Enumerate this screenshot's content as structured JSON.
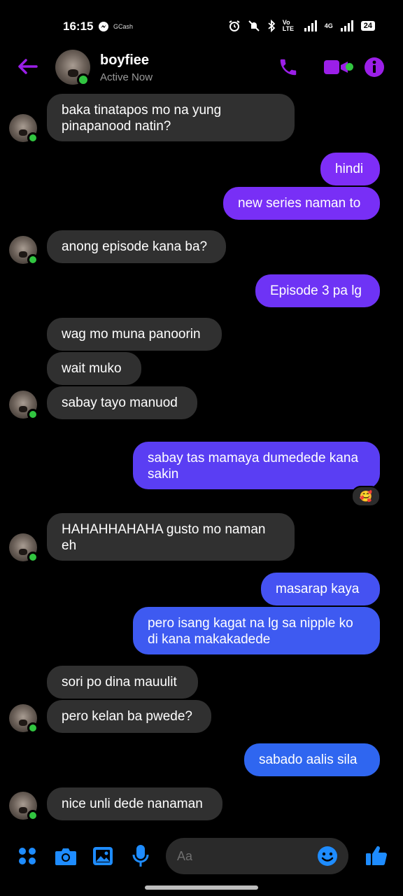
{
  "status_bar": {
    "time": "16:15",
    "left_app_label": "GCash",
    "network_label": "Vo LTE",
    "network_type": "4G",
    "battery": "24"
  },
  "header": {
    "contact_name": "boyfiee",
    "active_status": "Active Now"
  },
  "messages": [
    {
      "side": "in",
      "lines": [
        "baka tinatapos mo na yung",
        "pinapanood natin?"
      ]
    },
    {
      "side": "out",
      "text": "hindi"
    },
    {
      "side": "out",
      "text": "new series naman to"
    },
    {
      "side": "in",
      "text": "anong episode kana ba?"
    },
    {
      "side": "out",
      "text": "Episode 3 pa lg"
    },
    {
      "side": "in",
      "text": "wag mo muna panoorin"
    },
    {
      "side": "in",
      "text": "wait muko"
    },
    {
      "side": "in",
      "text": "sabay tayo manuod"
    },
    {
      "side": "out",
      "lines": [
        "sabay tas mamaya dumedede kana",
        "sakin"
      ],
      "reaction": "🥰"
    },
    {
      "side": "in",
      "lines": [
        "HAHAHHAHAHA gusto mo naman",
        "eh"
      ]
    },
    {
      "side": "out",
      "text": "masarap kaya"
    },
    {
      "side": "out",
      "lines": [
        "pero isang kagat na lg sa nipple ko",
        "di kana makakadede"
      ]
    },
    {
      "side": "in",
      "text": "sori po dina mauulit"
    },
    {
      "side": "in",
      "text": "pero kelan ba pwede?"
    },
    {
      "side": "out",
      "text": "sabado aalis sila"
    },
    {
      "side": "in",
      "text": "nice unli dede nanaman"
    }
  ],
  "composer": {
    "placeholder": "Aa"
  },
  "colors": {
    "accent": "#9b1fe8",
    "outgoing_top": "#7d2ff7",
    "outgoing_bottom": "#2f66f0",
    "incoming": "#303030",
    "composer_icons": "#1e8cff",
    "online": "#31c540"
  }
}
